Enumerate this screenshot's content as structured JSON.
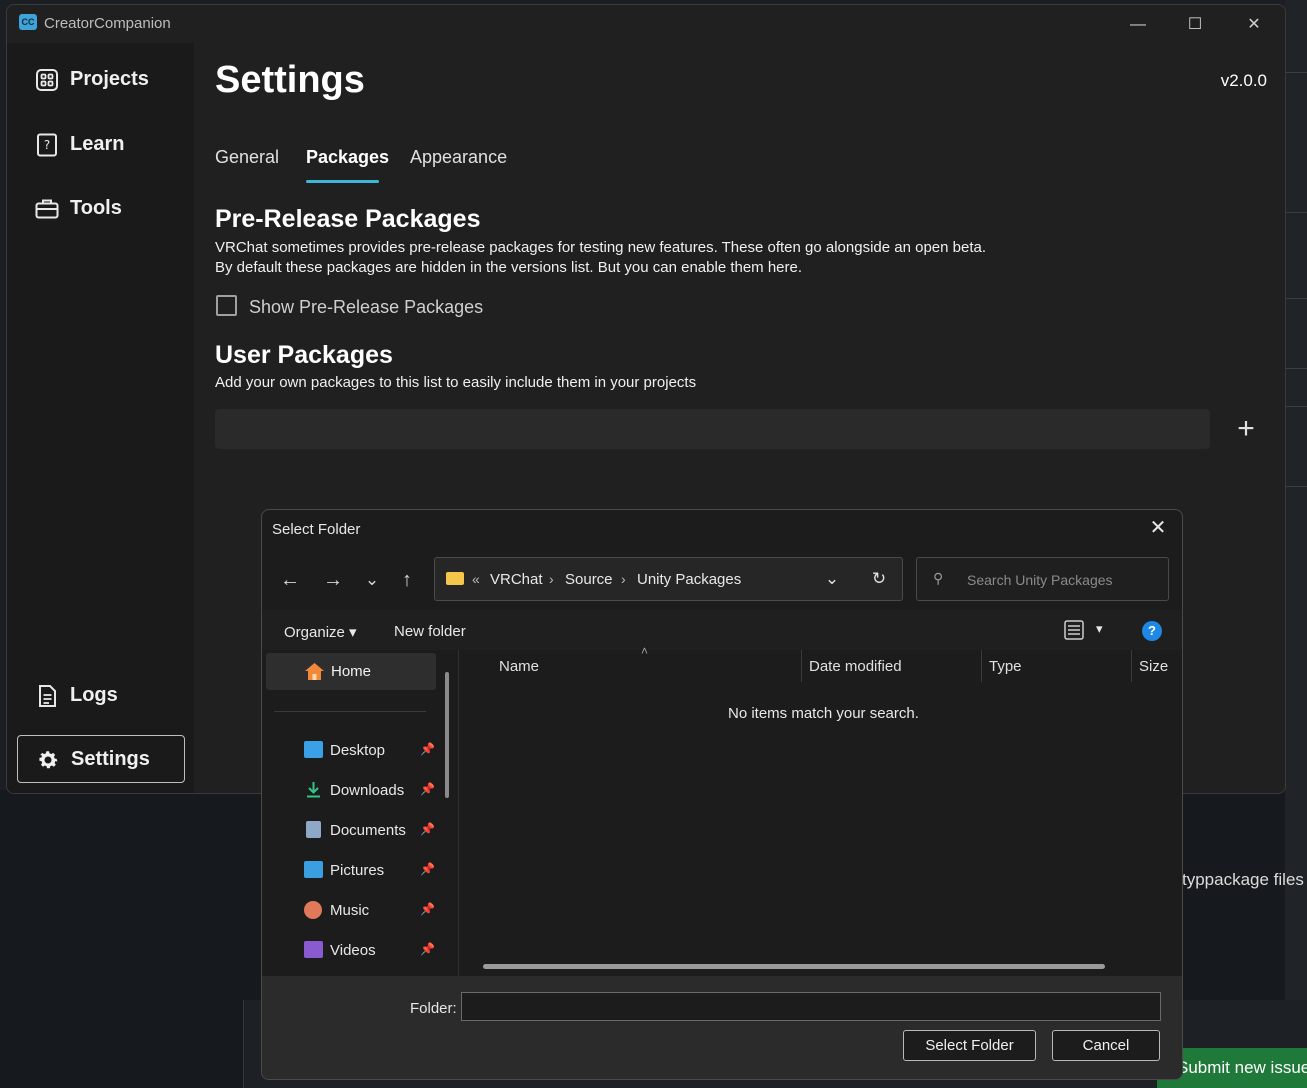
{
  "background": {
    "text": "typpackage files",
    "submit_label": "Submit new issue"
  },
  "window": {
    "title": "CreatorCompanion",
    "icon_text": "CC",
    "minimize": "—",
    "maximize": "☐",
    "close": "✕"
  },
  "sidebar": {
    "items": [
      {
        "label": "Projects",
        "icon": "projects-icon"
      },
      {
        "label": "Learn",
        "icon": "learn-icon"
      },
      {
        "label": "Tools",
        "icon": "tools-icon"
      },
      {
        "label": "Logs",
        "icon": "logs-icon"
      },
      {
        "label": "Settings",
        "icon": "gear-icon",
        "active": true
      }
    ]
  },
  "settings": {
    "title": "Settings",
    "version": "v2.0.0",
    "tabs": [
      {
        "label": "General"
      },
      {
        "label": "Packages",
        "active": true
      },
      {
        "label": "Appearance"
      }
    ],
    "prerelease": {
      "heading": "Pre-Release Packages",
      "line1": "VRChat sometimes provides pre-release packages for testing new features. These often go alongside an open beta.",
      "line2": "By default these packages are hidden in the versions list. But you can enable them here.",
      "checkbox_label": "Show Pre-Release Packages",
      "checked": false
    },
    "user_packages": {
      "heading": "User Packages",
      "description": "Add your own packages to this list to easily include them in your projects",
      "add_symbol": "+"
    }
  },
  "dialog": {
    "title": "Select Folder",
    "close": "✕",
    "nav": {
      "back": "←",
      "forward": "→",
      "recent": "⌄",
      "up": "↑"
    },
    "address": {
      "overflow": "«",
      "crumbs": [
        "VRChat",
        "Source",
        "Unity Packages"
      ],
      "separator": "›",
      "dropdown": "⌄",
      "refresh": "↻"
    },
    "search_placeholder": "Search Unity Packages",
    "toolbar": {
      "organize": "Organize ▾",
      "new_folder": "New folder",
      "help": "?",
      "view_caret": "▾"
    },
    "tree": {
      "home": "Home",
      "items": [
        {
          "label": "Desktop",
          "color": "#3aa0e8"
        },
        {
          "label": "Downloads",
          "color": "#34c48a"
        },
        {
          "label": "Documents",
          "color": "#8fa8c8"
        },
        {
          "label": "Pictures",
          "color": "#3a9ee0"
        },
        {
          "label": "Music",
          "color": "#e0785a"
        },
        {
          "label": "Videos",
          "color": "#8a5ad0"
        }
      ],
      "pin": "📌"
    },
    "columns": [
      "Name",
      "Date modified",
      "Type",
      "Size"
    ],
    "sort_indicator": "˄",
    "empty_message": "No items match your search.",
    "footer": {
      "folder_label": "Folder:",
      "folder_value": "",
      "select_button": "Select Folder",
      "cancel_button": "Cancel"
    }
  },
  "colors": {
    "accent": "#3fb8d8",
    "help": "#1e88e5",
    "folder": "#f4c74a"
  }
}
